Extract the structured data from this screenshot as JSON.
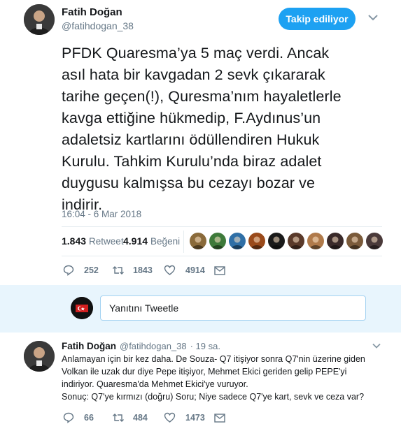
{
  "tweet": {
    "author_name": "Fatih Doğan",
    "author_handle": "@fatihdogan_38",
    "follow_label": "Takip ediliyor",
    "text_lines": [
      "PFDK Quaresma’ya 5 maç verdi. Ancak",
      "asıl hata bir kavgadan 2 sevk çıkararak",
      "tarihe geçen(!), Quresma’nım hayaletlerle",
      "kavga ettiğine hükmedip, F.Aydınus’un",
      "adaletsiz kartlarını ödüllendiren Hukuk",
      "Kurulu. Tahkim Kurulu’nda biraz adalet",
      "duygusu kalmışsa bu cezayı bozar ve",
      "indirir."
    ],
    "timestamp": "16:04 - 6 Mar 2018",
    "retweets": "1.843",
    "retweets_label": "Retweet",
    "likes": "4.914",
    "likes_label": "Beğeni",
    "likers": [
      "#8a6a3a",
      "#3e7a3a",
      "#2f6fa6",
      "#9a4a1a",
      "#1a1a1a",
      "#5a3a2a",
      "#b07a4a",
      "#3a2a2a",
      "#7a5a3a",
      "#4a3a3a"
    ],
    "actions": {
      "replies": "252",
      "retweets": "1843",
      "likes": "4914"
    }
  },
  "compose": {
    "placeholder": "Yanıtını Tweetle"
  },
  "reply": {
    "author_name": "Fatih Doğan",
    "author_handle": "@fatihdogan_38",
    "time": "· 19 sa.",
    "lines": [
      "Anlamayan için bir kez daha. De Souza- Q7 itişiyor sonra Q7'nin üzerine giden",
      "Volkan ile uzak dur diye Pepe itişiyor, Mehmet Ekici geriden gelip PEPE'yi",
      "indiriyor. Quaresma'da Mehmet Ekici'ye vuruyor.",
      "Sonuç: Q7'ye kırmızı (doğru) Soru; Niye sadece Q7'ye kart, sevk ve ceza var?"
    ],
    "actions": {
      "replies": "66",
      "retweets": "484",
      "likes": "1473"
    }
  }
}
